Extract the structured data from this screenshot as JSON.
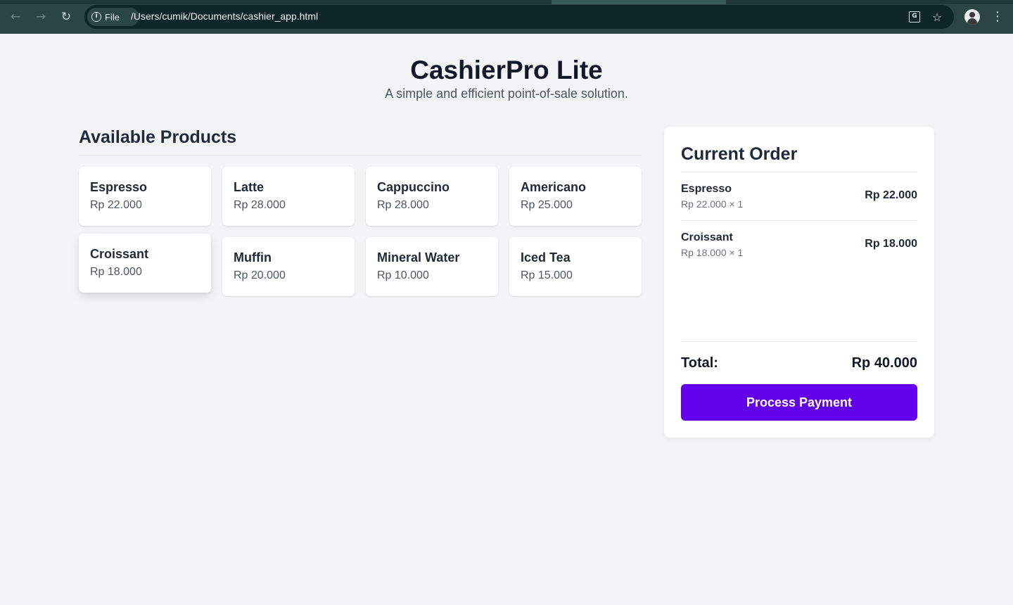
{
  "browser": {
    "site_chip_label": "File",
    "url": "/Users/cumik/Documents/cashier_app.html",
    "icons": [
      "back-icon",
      "forward-icon",
      "reload-icon",
      "info-icon",
      "translate-icon",
      "star-icon",
      "avatar",
      "more-menu-icon"
    ]
  },
  "header": {
    "title": "CashierPro Lite",
    "subtitle": "A simple and efficient point-of-sale solution."
  },
  "products": {
    "title": "Available Products",
    "items": [
      {
        "name": "Espresso",
        "price": "Rp 22.000"
      },
      {
        "name": "Latte",
        "price": "Rp 28.000"
      },
      {
        "name": "Cappuccino",
        "price": "Rp 28.000"
      },
      {
        "name": "Americano",
        "price": "Rp 25.000"
      },
      {
        "name": "Croissant",
        "price": "Rp 18.000"
      },
      {
        "name": "Muffin",
        "price": "Rp 20.000"
      },
      {
        "name": "Mineral Water",
        "price": "Rp 10.000"
      },
      {
        "name": "Iced Tea",
        "price": "Rp 15.000"
      }
    ]
  },
  "order": {
    "title": "Current Order",
    "items": [
      {
        "name": "Espresso",
        "qty_line": "Rp 22.000 × 1",
        "total": "Rp 22.000"
      },
      {
        "name": "Croissant",
        "qty_line": "Rp 18.000 × 1",
        "total": "Rp 18.000"
      }
    ],
    "total_label": "Total:",
    "total_value": "Rp 40.000",
    "pay_label": "Process Payment"
  },
  "colors": {
    "accent": "#6200ea",
    "page_bg": "#f3f4f6",
    "chrome_bg": "#2b4545"
  }
}
